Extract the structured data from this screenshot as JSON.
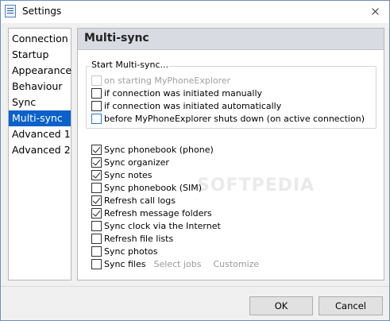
{
  "window": {
    "title": "Settings"
  },
  "nav": {
    "items": [
      {
        "label": "Connection",
        "active": false
      },
      {
        "label": "Startup",
        "active": false
      },
      {
        "label": "Appearance",
        "active": false
      },
      {
        "label": "Behaviour",
        "active": false
      },
      {
        "label": "Sync",
        "active": false
      },
      {
        "label": "Multi-sync",
        "active": true
      },
      {
        "label": "Advanced 1",
        "active": false
      },
      {
        "label": "Advanced 2",
        "active": false
      }
    ]
  },
  "panel": {
    "title": "Multi-sync",
    "start_group": {
      "title": "Start Multi-sync...",
      "options": [
        {
          "label": "on starting MyPhoneExplorer",
          "checked": false,
          "disabled": true
        },
        {
          "label": "if connection was initiated manually",
          "checked": false,
          "disabled": false
        },
        {
          "label": "if connection was initiated automatically",
          "checked": false,
          "disabled": false
        },
        {
          "label": "before MyPhoneExplorer shuts down (on active connection)",
          "checked": false,
          "disabled": false
        }
      ]
    },
    "sync_items": [
      {
        "label": "Sync phonebook (phone)",
        "checked": true
      },
      {
        "label": "Sync organizer",
        "checked": true
      },
      {
        "label": "Sync notes",
        "checked": true
      },
      {
        "label": "Sync phonebook (SIM)",
        "checked": false
      },
      {
        "label": "Refresh call logs",
        "checked": true
      },
      {
        "label": "Refresh message folders",
        "checked": true
      },
      {
        "label": "Sync clock via the Internet",
        "checked": false
      },
      {
        "label": "Refresh file lists",
        "checked": false
      },
      {
        "label": "Sync photos",
        "checked": false
      },
      {
        "label": "Sync files",
        "checked": false
      }
    ],
    "sync_files_links": {
      "select_jobs": "Select jobs",
      "customize": "Customize"
    },
    "watermark": "SOFTPEDIA"
  },
  "footer": {
    "ok_label": "OK",
    "cancel_label": "Cancel"
  },
  "colors": {
    "selection": "#0a61c9",
    "header_bg": "#d8dbe1",
    "window_border": "#6b8fbf"
  }
}
